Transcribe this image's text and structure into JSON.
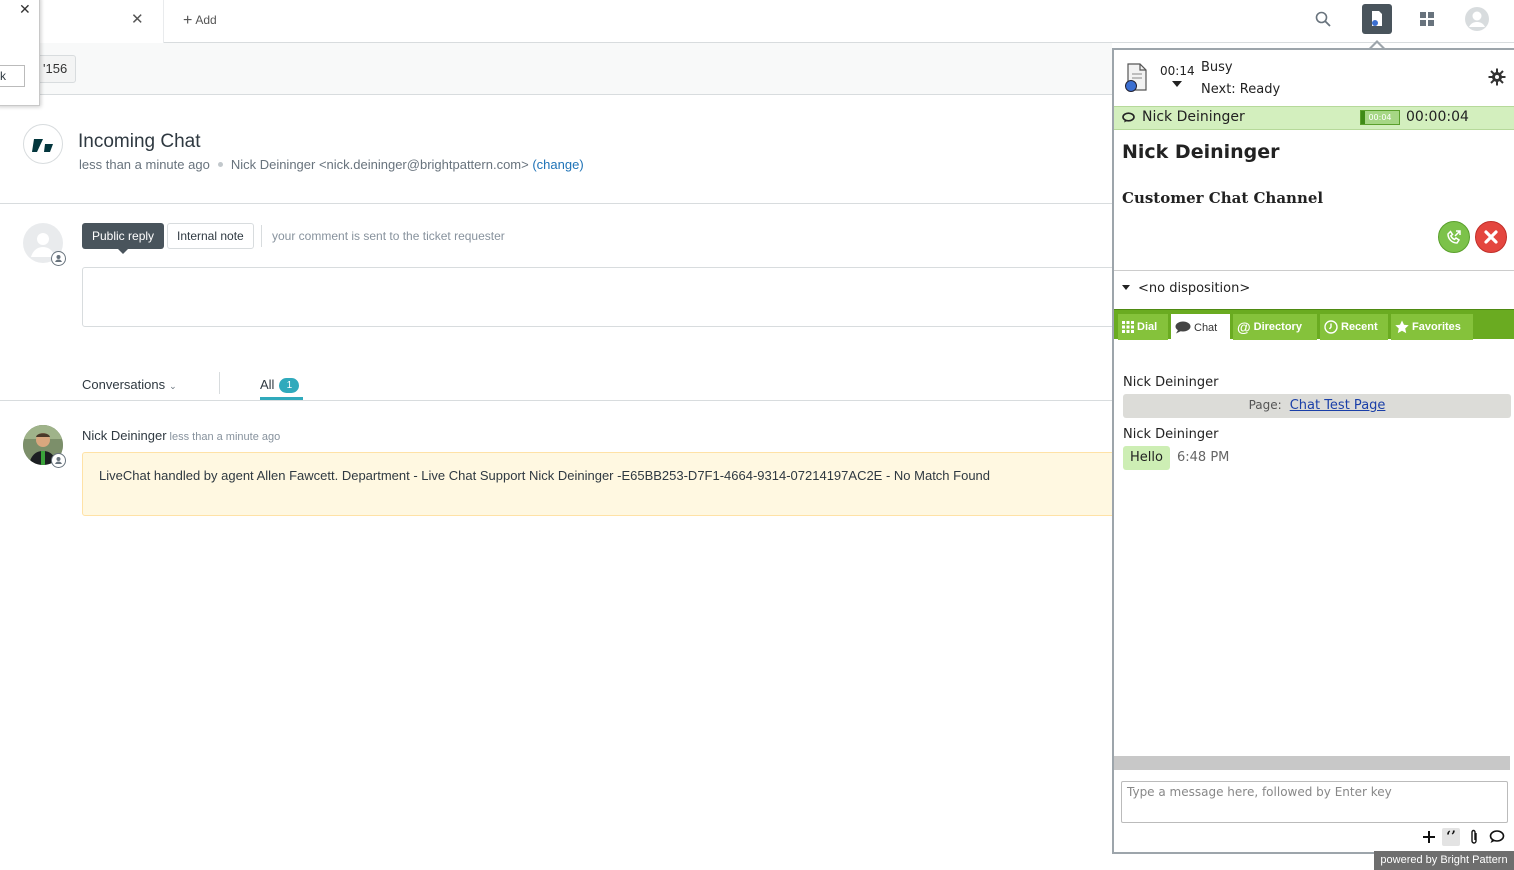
{
  "topbar": {
    "add_tab_label": "Add"
  },
  "popover": {
    "field_value": "k"
  },
  "subbar": {
    "ticket_id_fragment": "'156"
  },
  "ticket": {
    "title": "Incoming Chat",
    "created": "less than a minute ago",
    "requester": "Nick Deininger <nick.deininger@brightpattern.com>",
    "change_link": "(change)"
  },
  "composer": {
    "public_reply": "Public reply",
    "internal_note": "Internal note",
    "hint": "your comment is sent to the ticket requester"
  },
  "filter": {
    "conversations": "Conversations",
    "all": "All",
    "all_count": "1"
  },
  "comment": {
    "author": "Nick Deininger",
    "time": "less than a minute ago",
    "body": "LiveChat handled by agent Allen Fawcett. Department - Live Chat Support Nick Deininger -E65BB253-D7F1-4664-9314-07214197AC2E - No Match Found"
  },
  "agent": {
    "timer": "00:14",
    "status": "Busy",
    "next_status": "Next: Ready",
    "active_name": "Nick Deininger",
    "mini_timer": "00:04",
    "active_time": "00:00:04",
    "contact_name": "Nick Deininger",
    "channel": "Customer Chat Channel",
    "disposition": "<no disposition>",
    "tabs": [
      "Dial",
      "Chat",
      "Directory",
      "Recent",
      "Favorites"
    ],
    "messages": {
      "sender1": "Nick Deininger",
      "page_label": "Page:",
      "page_link": "Chat Test Page",
      "sender2": "Nick Deininger",
      "hello": "Hello",
      "hello_time": "6:48 PM"
    },
    "input_placeholder": "Type a message here, followed by Enter key",
    "powered_by": "powered by Bright Pattern"
  },
  "colors": {
    "accent_green": "#6aab21",
    "active_row": "#d3efbe",
    "end_red": "#e4463f",
    "zendesk_teal": "#30aabc",
    "link_blue": "#1f73b7"
  }
}
